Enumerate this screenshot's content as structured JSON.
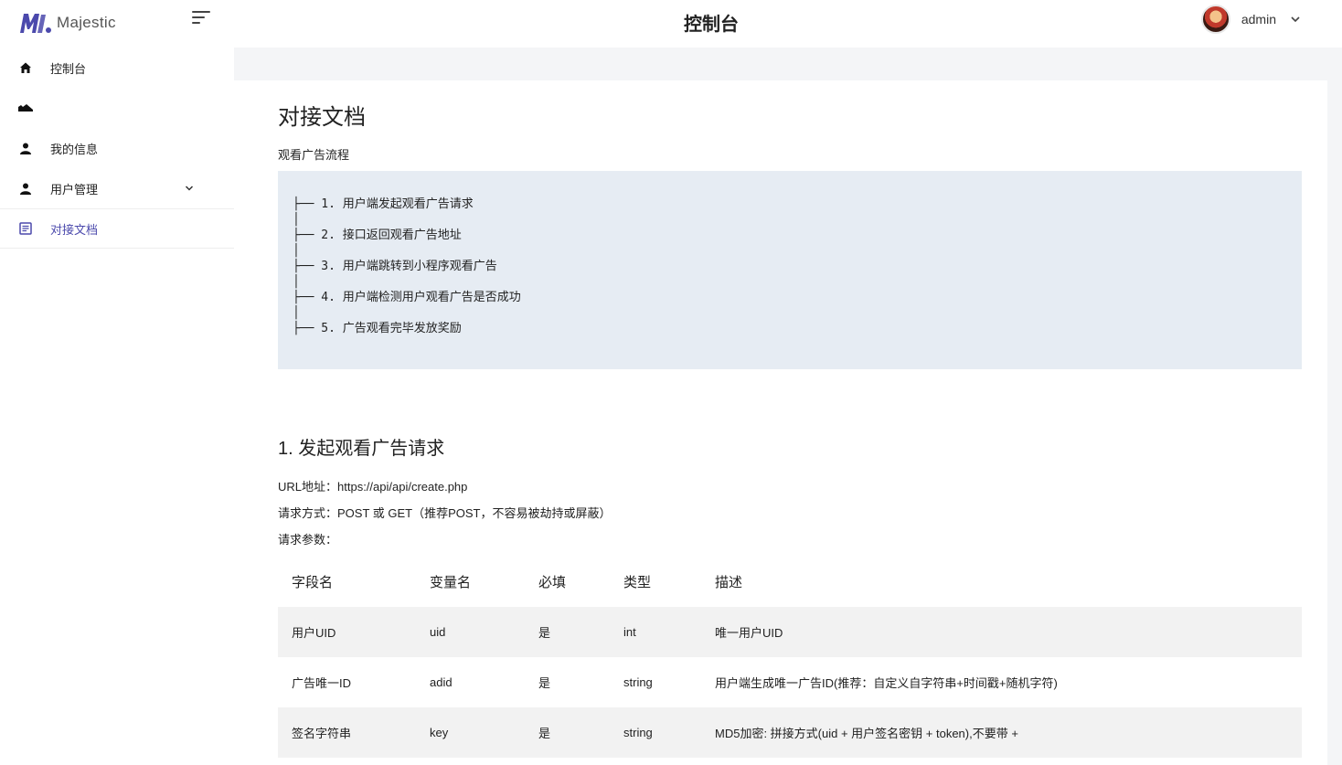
{
  "brand": {
    "name": "Majestic",
    "logo_icon": "majestic-logo"
  },
  "header": {
    "title": "控制台",
    "user_name": "admin"
  },
  "colors": {
    "accent": "#4b49ac",
    "code_bg": "#e6ecf3",
    "stripe": "#f2f2f2",
    "page_bg": "#f4f5f7"
  },
  "sidebar": {
    "items": [
      {
        "label": "控制台",
        "icon": "home-icon"
      },
      {
        "label": "",
        "icon": "landscape-icon"
      },
      {
        "label": "我的信息",
        "icon": "person-icon"
      },
      {
        "label": "用户管理",
        "icon": "person-icon"
      },
      {
        "label": "对接文档",
        "icon": "document-icon"
      }
    ]
  },
  "doc": {
    "title": "对接文档",
    "flow_title": "观看广告流程",
    "flow_lines": [
      "├── 1. 用户端发起观看广告请求",
      "│",
      "├── 2. 接口返回观看广告地址",
      "│",
      "├── 3. 用户端跳转到小程序观看广告",
      "│",
      "├── 4. 用户端检测用户观看广告是否成功",
      "│",
      "├── 5. 广告观看完毕发放奖励"
    ],
    "section1": {
      "title": "1. 发起观看广告请求",
      "url": "URL地址：https://api/api/create.php",
      "method": "请求方式：POST 或 GET（推荐POST，不容易被劫持或屏蔽）",
      "params_label": "请求参数："
    },
    "table": {
      "headers": [
        "字段名",
        "变量名",
        "必填",
        "类型",
        "描述"
      ],
      "rows": [
        [
          "用户UID",
          "uid",
          "是",
          "int",
          "唯一用户UID"
        ],
        [
          "广告唯一ID",
          "adid",
          "是",
          "string",
          "用户端生成唯一广告ID(推荐：自定义自字符串+时间戳+随机字符)"
        ],
        [
          "签名字符串",
          "key",
          "是",
          "string",
          "MD5加密: 拼接方式(uid + 用户签名密钥 + token),不要带 +"
        ]
      ]
    }
  }
}
